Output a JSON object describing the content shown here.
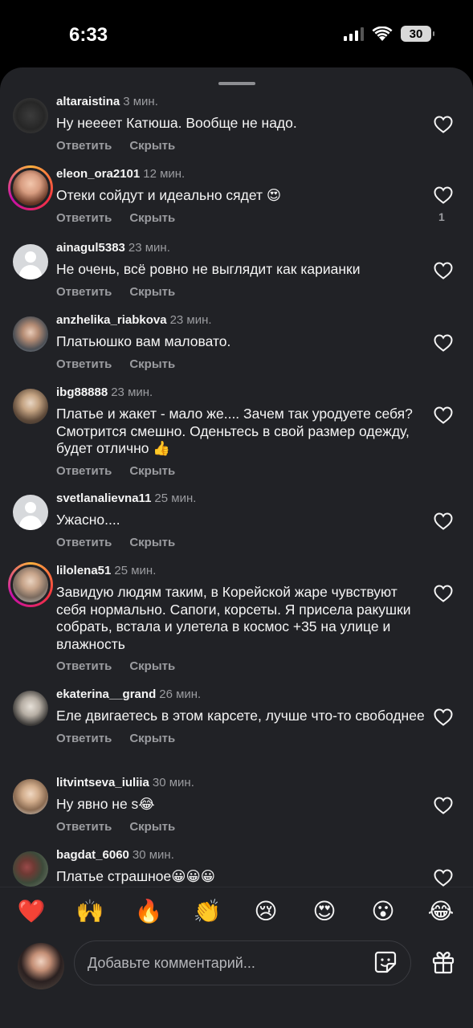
{
  "status": {
    "time": "6:33",
    "battery": "30"
  },
  "comments": [
    {
      "user": "altaraistina",
      "time": "3 мин.",
      "text": "Ну неееет Катюша. Вообще не надо.",
      "likes": ""
    },
    {
      "user": "eleon_ora2101",
      "time": "12 мин.",
      "text": "Отеки сойдут и идеально сядет 😍",
      "likes": "1"
    },
    {
      "user": "ainagul5383",
      "time": "23 мин.",
      "text": "Не очень, всё ровно не выглядит как карианки",
      "likes": ""
    },
    {
      "user": "anzhelika_riabkova",
      "time": "23 мин.",
      "text": "Платьюшко вам маловато.",
      "likes": ""
    },
    {
      "user": "ibg88888",
      "time": "23 мин.",
      "text": "Платье и жакет - мало же.... Зачем так уродуете себя? Смотрится смешно. Оденьтесь в свой размер одежду, будет отлично 👍",
      "likes": ""
    },
    {
      "user": "svetlanalievna11",
      "time": "25 мин.",
      "text": "Ужасно....",
      "likes": ""
    },
    {
      "user": "lilolena51",
      "time": "25 мин.",
      "text": "Завидую людям таким, в Корейской жаре чувствуют себя нормально. Сапоги, корсеты. Я присела ракушки собрать, встала и улетела в космос +35 на улице и влажность",
      "likes": ""
    },
    {
      "user": "ekaterina__grand",
      "time": "26 мин.",
      "text": "Еле двигаетесь в этом карсете, лучше что-то свободнее",
      "likes": ""
    },
    {
      "user": "litvintseva_iuliia",
      "time": "30 мин.",
      "text": "Ну явно не s😂",
      "likes": ""
    },
    {
      "user": "bagdat_6060",
      "time": "30 мин.",
      "text": "Платье страшное😀😀😀",
      "likes": ""
    }
  ],
  "actions": {
    "reply": "Ответить",
    "hide": "Скрыть"
  },
  "reactions": [
    "❤️",
    "🙌",
    "🔥",
    "👏",
    "😢",
    "😍",
    "😮",
    "😂"
  ],
  "composer": {
    "placeholder": "Добавьте комментарий..."
  }
}
